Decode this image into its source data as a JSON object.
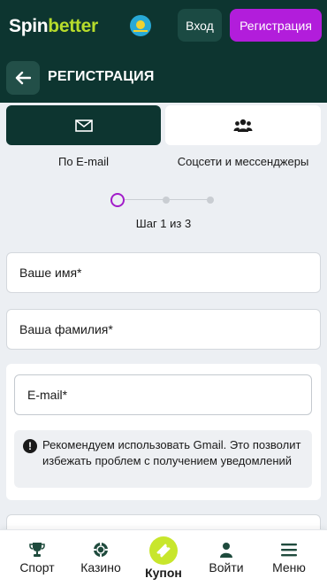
{
  "header": {
    "logo_spin": "Spin",
    "logo_better": "better",
    "login_label": "Вход",
    "register_label": "Регистрация"
  },
  "subheader": {
    "title": "РЕГИСТРАЦИЯ"
  },
  "methods": {
    "email_label": "По E-mail",
    "social_label": "Соцсети и мессенджеры",
    "selected": "email"
  },
  "stepper": {
    "text": "Шаг 1 из 3",
    "current": 1,
    "total": 3,
    "accent": "#a21cc9"
  },
  "form": {
    "first_name_placeholder": "Ваше имя*",
    "last_name_placeholder": "Ваша фамилия*",
    "email_placeholder": "E-mail*",
    "notice": "Рекомендуем использовать Gmail. Это позволит избежать проблем с получением уведомлений"
  },
  "bottom_nav": {
    "items": [
      {
        "label": "Спорт",
        "icon": "trophy-icon"
      },
      {
        "label": "Казино",
        "icon": "casino-chip-icon"
      },
      {
        "label": "Купон",
        "icon": "ticket-icon"
      },
      {
        "label": "Войти",
        "icon": "user-icon"
      },
      {
        "label": "Меню",
        "icon": "hamburger-icon"
      }
    ]
  },
  "colors": {
    "header_bg": "#0d3530",
    "brand_green": "#b7dc2c",
    "register_purple": "#b21ddb",
    "coupon_lime": "#c8e62c"
  }
}
